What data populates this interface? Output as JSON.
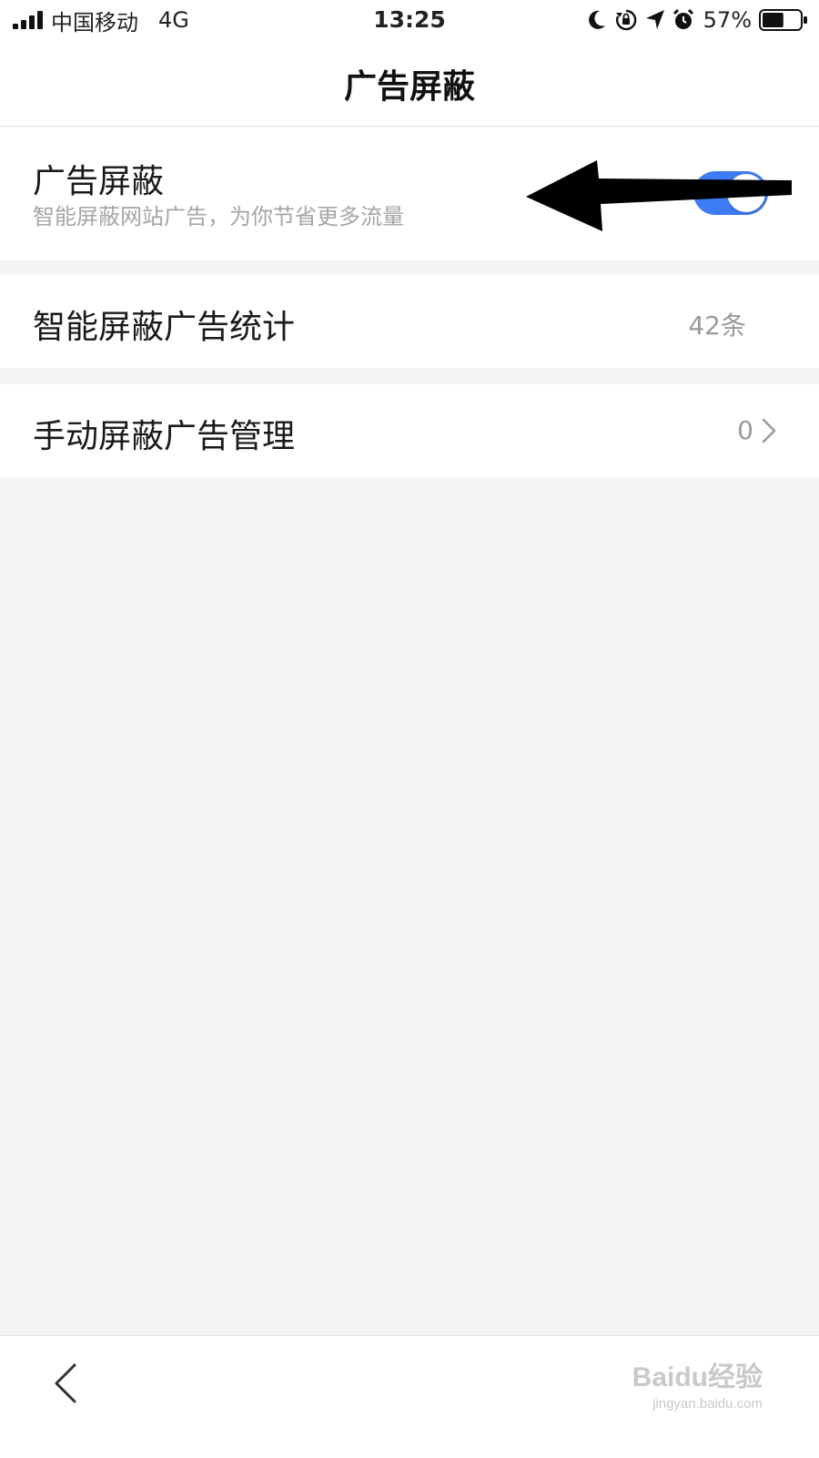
{
  "status_bar": {
    "carrier": "中国移动",
    "network": "4G",
    "time": "13:25",
    "battery_percent": "57%",
    "battery_level": 0.57,
    "icons": [
      "signal-icon",
      "moon-icon",
      "orientation-lock-icon",
      "location-icon",
      "alarm-icon",
      "battery-icon"
    ]
  },
  "nav": {
    "title": "广告屏蔽"
  },
  "ad_block": {
    "title": "广告屏蔽",
    "subtitle": "智能屏蔽网站广告，为你节省更多流量",
    "enabled": true,
    "accent_color": "#3e7bf6"
  },
  "smart_stats": {
    "title": "智能屏蔽广告统计",
    "value": "42条"
  },
  "manual_manage": {
    "title": "手动屏蔽广告管理",
    "value": "0"
  },
  "watermark": {
    "logo": "Baidu经验",
    "url": "jingyan.baidu.com"
  }
}
